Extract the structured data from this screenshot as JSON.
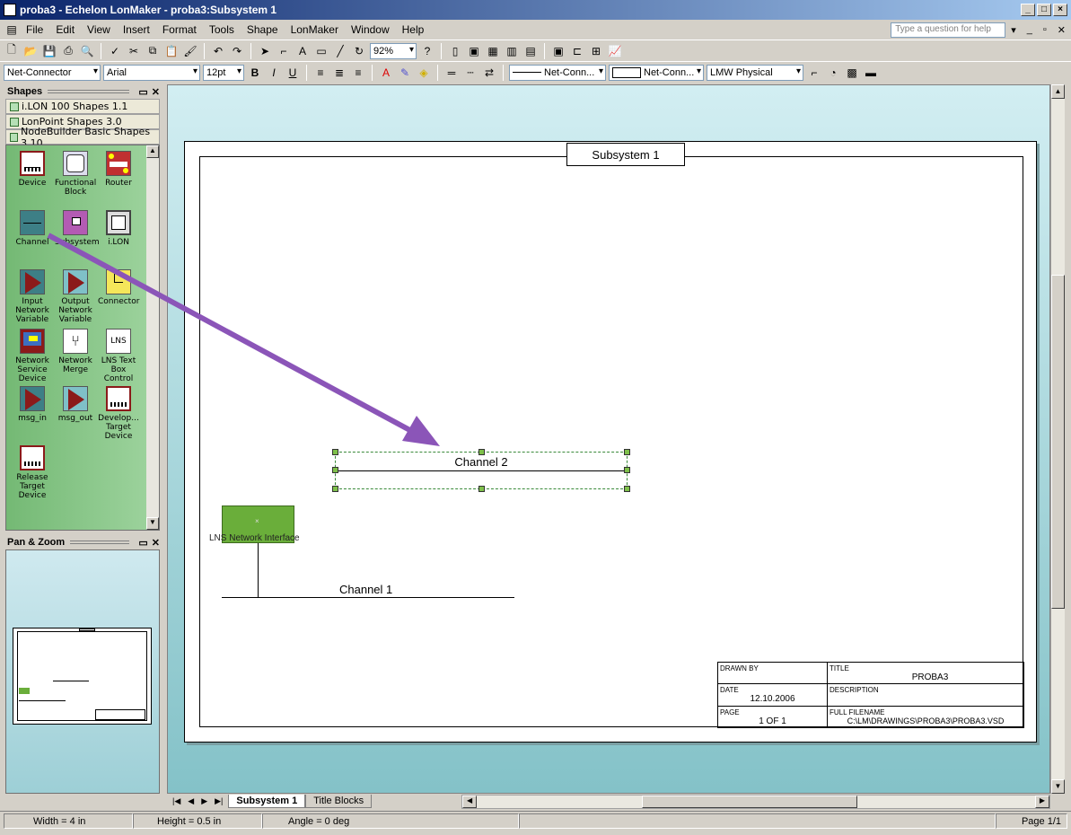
{
  "window": {
    "title": "proba3 - Echelon LonMaker - proba3:Subsystem 1",
    "controls": [
      "_",
      "□",
      "×"
    ]
  },
  "menu": {
    "items": [
      "File",
      "Edit",
      "View",
      "Insert",
      "Format",
      "Tools",
      "Shape",
      "LonMaker",
      "Window",
      "Help"
    ],
    "help_placeholder": "Type a question for help"
  },
  "toolbar1": {
    "zoom": "92%"
  },
  "toolbar2": {
    "style": "Net-Connector",
    "font": "Arial",
    "size": "12pt",
    "bold": "B",
    "italic": "I",
    "underline": "U",
    "line_style1": "Net-Conn...",
    "line_style2": "Net-Conn...",
    "layer": "LMW Physical"
  },
  "shapes_panel": {
    "title": "Shapes",
    "stencils": [
      "i.LON 100 Shapes 1.1",
      "LonPoint Shapes 3.0",
      "NodeBuilder Basic Shapes 3.10"
    ],
    "masters": [
      {
        "label": "Device",
        "icon": "device-icon"
      },
      {
        "label": "Functional Block",
        "icon": "functional-block-icon"
      },
      {
        "label": "Router",
        "icon": "router-icon"
      },
      {
        "label": "Channel",
        "icon": "channel-icon"
      },
      {
        "label": "Subsystem",
        "icon": "subsystem-icon"
      },
      {
        "label": "i.LON",
        "icon": "ilon-icon"
      },
      {
        "label": "Input Network Variable",
        "icon": "input-nv-icon"
      },
      {
        "label": "Output Network Variable",
        "icon": "output-nv-icon"
      },
      {
        "label": "Connector",
        "icon": "connector-icon"
      },
      {
        "label": "Network Service Device",
        "icon": "network-service-device-icon"
      },
      {
        "label": "Network Merge",
        "icon": "network-merge-icon"
      },
      {
        "label": "LNS Text Box Control",
        "icon": "lns-text-box-icon"
      },
      {
        "label": "msg_in",
        "icon": "msg-in-icon"
      },
      {
        "label": "msg_out",
        "icon": "msg-out-icon"
      },
      {
        "label": "Develop... Target Device",
        "icon": "develop-target-icon"
      },
      {
        "label": "Release Target Device",
        "icon": "release-target-icon"
      }
    ]
  },
  "panzoom": {
    "title": "Pan & Zoom"
  },
  "drawing": {
    "subsystem_title": "Subsystem 1",
    "channel2_label": "Channel 2",
    "channel1_label": "Channel 1",
    "lns_label": "LNS Network Interface",
    "title_block": {
      "drawn_by_label": "DRAWN BY",
      "drawn_by": "",
      "title_label": "TITLE",
      "title": "PROBA3",
      "date_label": "DATE",
      "date": "12.10.2006",
      "description_label": "DESCRIPTION",
      "page_label": "PAGE",
      "page": "1 OF 1",
      "filename_label": "FULL FILENAME",
      "filename": "C:\\LM\\DRAWINGS\\PROBA3\\PROBA3.VSD"
    }
  },
  "page_tabs": [
    "Subsystem 1",
    "Title Blocks"
  ],
  "status": {
    "width": "Width = 4 in",
    "height": "Height = 0.5 in",
    "angle": "Angle = 0 deg",
    "page": "Page 1/1"
  },
  "colors": {
    "arrow": "#8b55b8",
    "stencil_bg": "#86c586",
    "canvas_bg": "#a8d8de",
    "lns_device": "#6aae3a"
  }
}
